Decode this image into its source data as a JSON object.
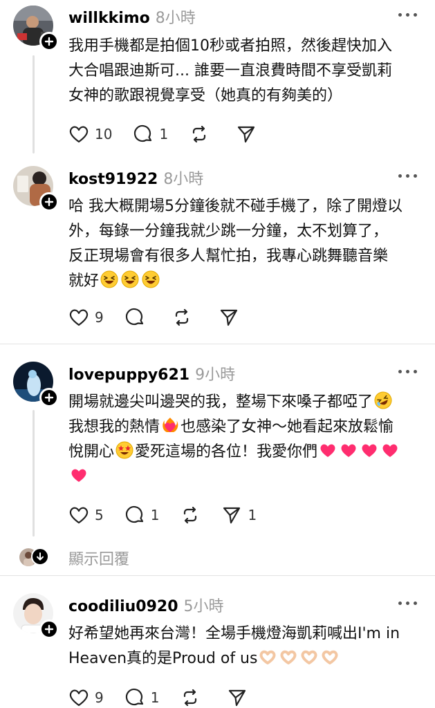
{
  "posts": [
    {
      "username": "willkkimo",
      "time": "8小時",
      "lines": [
        "我用手機都是拍個10秒或者拍照，然後趕快加入",
        "大合唱跟迪斯可... 誰要一直浪費時間不享受凱莉",
        "女神的歌跟視覺享受（她真的有夠美的）"
      ],
      "likes": "10",
      "replies": "1",
      "shares": ""
    },
    {
      "username": "kost91922",
      "time": "8小時",
      "lines": [
        "哈 我大概開場5分鐘後就不碰手機了，除了開燈以",
        "外，每錄一分鐘我就少跳一分鐘，太不划算了，",
        "反正現場會有很多人幫忙拍，我專心跳舞聽音樂",
        "就好"
      ],
      "likes": "9",
      "replies": "",
      "shares": ""
    },
    {
      "username": "lovepuppy621",
      "time": "9小時",
      "lines": [
        "開場就邊尖叫邊哭的我，整場下來嗓子都啞了",
        "我想我的熱情",
        "也感染了女神～她看起來放鬆愉",
        "悅開心",
        "愛死這場的各位！我愛你們"
      ],
      "likes": "5",
      "replies": "1",
      "shares": "1"
    },
    {
      "username": "coodiliu0920",
      "time": "5小時",
      "lines": [
        "好希望她再來台灣！全場手機燈海凱莉喊出I'm in",
        "Heaven真的是Proud of us"
      ],
      "likes": "9",
      "replies": "1",
      "shares": ""
    }
  ],
  "show_replies_label": "顯示回覆",
  "icons": {
    "like": "heart-icon",
    "reply": "comment-icon",
    "repost": "repost-icon",
    "share": "send-icon",
    "more": "more-icon",
    "follow": "plus-icon"
  },
  "colors": {
    "text": "#111111",
    "muted": "#9a9a9a",
    "divider": "#e2e2e2",
    "emoji_heart": "#ff2d6f"
  }
}
